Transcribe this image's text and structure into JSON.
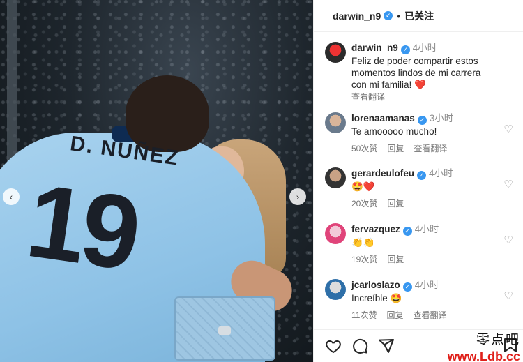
{
  "header": {
    "username": "darwin_n9",
    "dot": "•",
    "follow_label": "已关注"
  },
  "caption": {
    "username": "darwin_n9",
    "time": "4小时",
    "text": "Feliz de poder compartir estos momentos lindos de mi carrera con mi familia!",
    "translate": "查看翻译"
  },
  "comments": [
    {
      "username": "lorenaamanas",
      "time": "3小时",
      "text": "Te amooooo mucho!",
      "likes": "50次赞",
      "reply": "回复",
      "translate": "查看翻译"
    },
    {
      "username": "gerardeulofeu",
      "time": "4小时",
      "text": "🤩",
      "likes": "20次赞",
      "reply": "回复",
      "translate": ""
    },
    {
      "username": "fervazquez",
      "time": "4小时",
      "text": "👏👏",
      "likes": "19次赞",
      "reply": "回复",
      "translate": ""
    },
    {
      "username": "jcarloslazo",
      "time": "4小时",
      "text": "Increíble 🤩",
      "likes": "11次赞",
      "reply": "回复",
      "translate": "查看翻译"
    }
  ],
  "photo": {
    "jersey_name": "D. NUÑEZ",
    "jersey_number": "19"
  },
  "watermark": {
    "line1": "零点吧",
    "line2": "www.Ldb.cc"
  },
  "colors": {
    "verified": "#3897f0",
    "heart": "#ed1c24",
    "jersey": "#8ec2e6"
  }
}
